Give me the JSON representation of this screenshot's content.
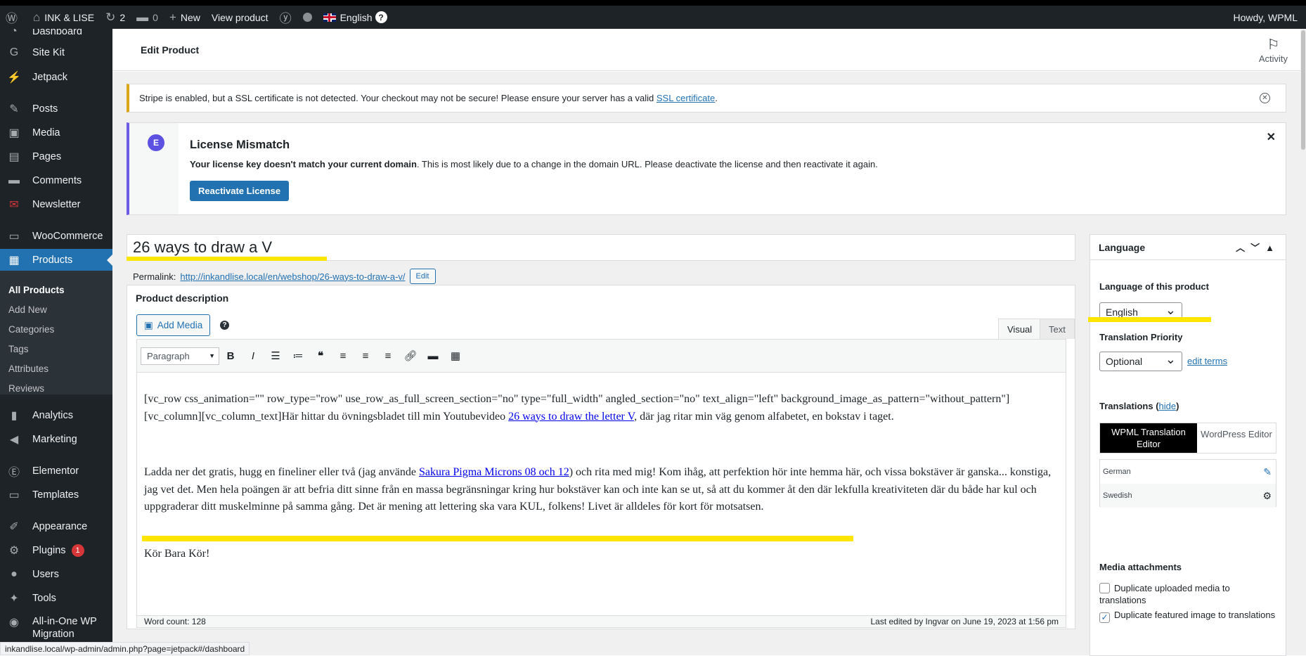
{
  "adminbar": {
    "site_name": "INK & LISE",
    "updates_count": "2",
    "comments_count": "0",
    "new_label": "New",
    "view_product": "View product",
    "language": "English",
    "howdy": "Howdy, WPML"
  },
  "sidebar": {
    "items": [
      {
        "label": "Dashboard",
        "icon": "dashboard-icon"
      },
      {
        "label": "Site Kit",
        "icon": "sitekit-icon"
      },
      {
        "label": "Jetpack",
        "icon": "jetpack-icon"
      },
      {
        "label": "Posts",
        "icon": "pin-icon"
      },
      {
        "label": "Media",
        "icon": "media-icon"
      },
      {
        "label": "Pages",
        "icon": "pages-icon"
      },
      {
        "label": "Comments",
        "icon": "comment-icon"
      },
      {
        "label": "Newsletter",
        "icon": "mail-icon"
      },
      {
        "label": "WooCommerce",
        "icon": "woo-icon"
      },
      {
        "label": "Products",
        "icon": "archive-icon"
      },
      {
        "label": "Analytics",
        "icon": "chart-icon"
      },
      {
        "label": "Marketing",
        "icon": "megaphone-icon"
      },
      {
        "label": "Elementor",
        "icon": "elementor-icon"
      },
      {
        "label": "Templates",
        "icon": "folder-icon"
      },
      {
        "label": "Appearance",
        "icon": "brush-icon"
      },
      {
        "label": "Plugins",
        "icon": "plug-icon",
        "badge": "1"
      },
      {
        "label": "Users",
        "icon": "user-icon"
      },
      {
        "label": "Tools",
        "icon": "wrench-icon"
      },
      {
        "label": "All-in-One WP",
        "label2": "Migration",
        "icon": "migration-icon"
      }
    ],
    "submenu": [
      "All Products",
      "Add New",
      "Categories",
      "Tags",
      "Attributes",
      "Reviews"
    ]
  },
  "header": {
    "title": "Edit Product",
    "activity": "Activity"
  },
  "notices": {
    "ssl_text": "Stripe is enabled, but a SSL certificate is not detected. Your checkout may not be secure! Please ensure your server has a valid ",
    "ssl_link": "SSL certificate",
    "ssl_end": ".",
    "license_title": "License Mismatch",
    "license_bold": "Your license key doesn't match your current domain",
    "license_text": ". This is most likely due to a change in the domain URL. Please deactivate the license and then reactivate it again.",
    "license_button": "Reactivate License"
  },
  "product": {
    "title": "26 ways to draw a V",
    "permalink_label": "Permalink:",
    "permalink_url": "http://inkandlise.local/en/webshop/26-ways-to-draw-a-v/",
    "permalink_edit": "Edit"
  },
  "editor": {
    "section_title": "Product description",
    "add_media": "Add Media",
    "tab_visual": "Visual",
    "tab_text": "Text",
    "format": "Paragraph",
    "p1_a": "[vc_row css_animation=\"\" row_type=\"row\" use_row_as_full_screen_section=\"no\" type=\"full_width\" angled_section=\"no\" text_align=\"left\" background_image_as_pattern=\"without_pattern\"][vc_column][vc_column_text]Här hittar du övningsbladet till min Youtubevideo ",
    "p1_link": "26 ways to draw the letter V",
    "p1_b": ", där jag ritar min väg genom alfabetet, en bokstav i taget.",
    "p2_a": "Ladda ner det gratis, hugg en fineliner eller två (jag använde ",
    "p2_link": "Sakura Pigma Microns 08 och 12",
    "p2_b": ") och rita med mig! Kom ihåg, att perfektion hör inte hemma här, och vissa bokstäver är ganska... konstiga, jag vet det. Men hela poängen är att befria ditt sinne från en massa begränsningar kring hur bokstäver kan och inte kan se ut, så att du kommer åt den där lekfulla kreativiteten där du både har kul och uppgraderar ditt muskelminne på samma gång. Det är mening att lettering ska vara KUL, folkens! Livet är alldeles för kort för motsatsen.",
    "p3": "Kör Bara Kör!",
    "word_count": "Word count: 128",
    "last_edited": "Last edited by Ingvar on June 19, 2023 at 1:56 pm"
  },
  "language_panel": {
    "title": "Language",
    "lang_label": "Language of this product",
    "lang_value": "English",
    "priority_label": "Translation Priority",
    "priority_value": "Optional",
    "edit_terms": "edit terms",
    "translations_label": "Translations (",
    "hide": "hide",
    "translations_end": ")",
    "btn_wpml_1": "WPML Translation",
    "btn_wpml_2": "Editor",
    "btn_wp": "WordPress Editor",
    "rows": [
      "German",
      "Swedish"
    ],
    "media_label": "Media attachments",
    "dup_media": "Duplicate uploaded media to translations",
    "dup_featured": "Duplicate featured image to translations"
  },
  "status_url": "inkandlise.local/wp-admin/admin.php?page=jetpack#/dashboard",
  "colors": {
    "highlight": "#ffe600",
    "accent": "#2271b1",
    "sidebar": "#1d2327"
  }
}
